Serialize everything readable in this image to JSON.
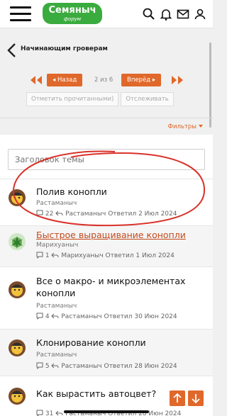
{
  "header": {
    "logo_main": "Семяныч",
    "logo_sub": "форум",
    "icons": [
      "menu-icon",
      "search-icon",
      "bell-icon",
      "mail-icon",
      "user-icon"
    ]
  },
  "breadcrumb": {
    "label": "Начинающим гроверам"
  },
  "pagination": {
    "back_label": "Назад",
    "page_text": "2 из 6",
    "forward_label": "Вперёд"
  },
  "actions": {
    "mark_read": "Отметить прочитанными)",
    "watch": "Отслеживать"
  },
  "filters": {
    "label": "Фильтры"
  },
  "search": {
    "placeholder": "Заголовок темы"
  },
  "threads": [
    {
      "title": "Полив конопли",
      "author": "Растаманыч",
      "replies": "22",
      "last": "Растаманыч Ответил 2 Июл 2024",
      "highlighted": true
    },
    {
      "title": "Быстрое выращивание конопли",
      "author": "Марихуаныч",
      "replies": "1",
      "last": "Марихуаныч Ответил 1 Июл 2024"
    },
    {
      "title": "Все о макро- и микроэлементах конопли",
      "author": "Растаманыч",
      "replies": "4",
      "last": "Растаманыч Ответил 30 Июн 2024"
    },
    {
      "title": "Клонирование конопли",
      "author": "Растаманыч",
      "replies": "5",
      "last": "Растаманыч Ответил 28 Июн 2024"
    },
    {
      "title": "Как вырастить автоцвет?",
      "author": "",
      "replies": "31",
      "last": "Растаманыч Ответил 28 Июн 2024"
    }
  ],
  "colors": {
    "accent": "#e0682a",
    "brand": "#3aab3e",
    "annotation": "#d9322a"
  }
}
